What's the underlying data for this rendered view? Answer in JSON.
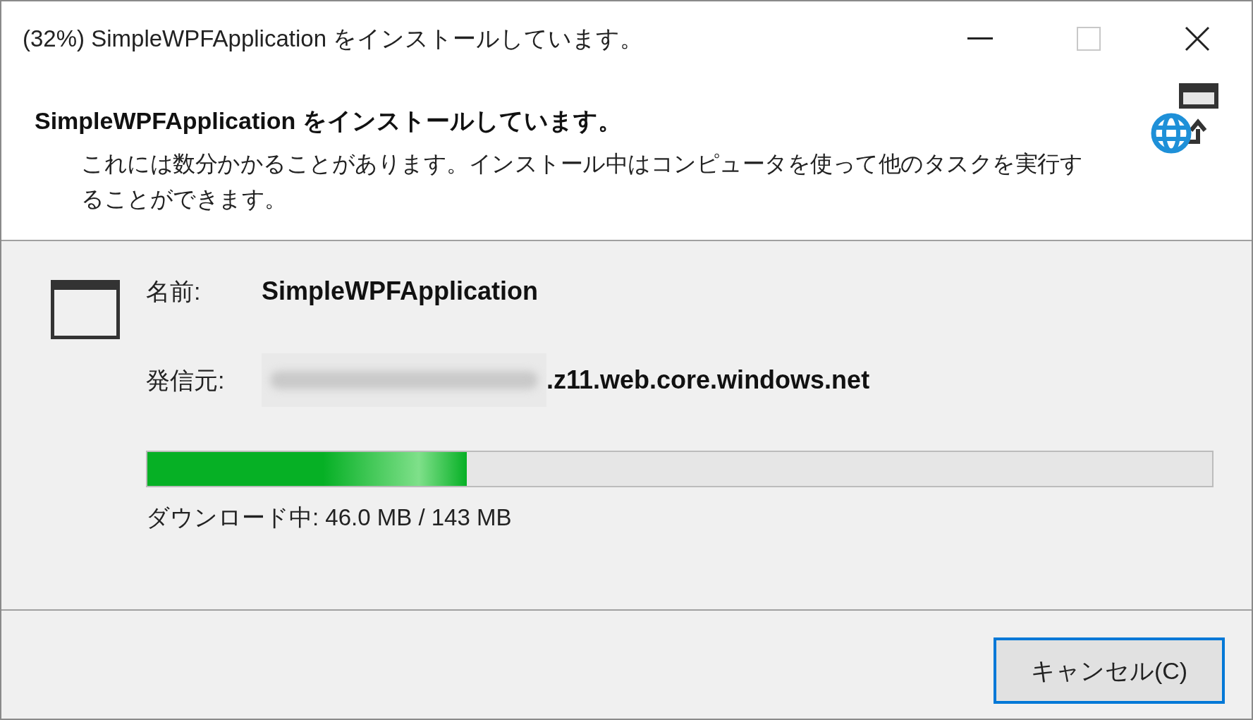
{
  "window": {
    "title": "(32%) SimpleWPFApplication をインストールしています。"
  },
  "header": {
    "heading": "SimpleWPFApplication をインストールしています。",
    "description": "これには数分かかることがあります。インストール中はコンピュータを使って他のタスクを実行することができます。"
  },
  "details": [
    {
      "label": "名前:",
      "value": "SimpleWPFApplication",
      "kind": "name"
    },
    {
      "label": "発信元:",
      "value": ".z11.web.core.windows.net",
      "kind": "publisher"
    }
  ],
  "progress": {
    "level": 0.3,
    "status": "ダウンロード中: 46.0 MB / 143 MB"
  },
  "buttons": [
    {
      "label": "キャンセル(C)",
      "selected": true
    }
  ]
}
